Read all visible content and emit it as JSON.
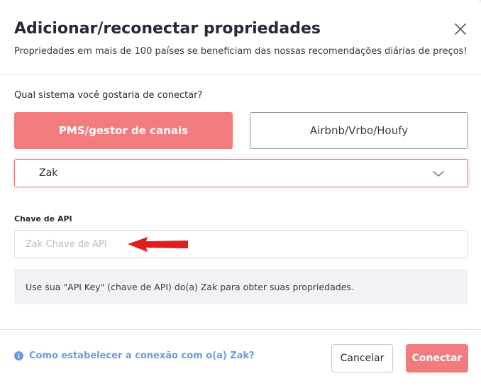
{
  "dialog": {
    "title": "Adicionar/reconectar propriedades",
    "subtitle": "Propriedades em mais de 100 países se beneficiam das nossas recomendações diárias de preços!",
    "close_icon": "close-icon"
  },
  "system_selection": {
    "question": "Qual sistema você gostaria de conectar?",
    "options": [
      {
        "label": "PMS/gestor de canais",
        "selected": true
      },
      {
        "label": "Airbnb/Vrbo/Houfy",
        "selected": false
      }
    ],
    "dropdown": {
      "selected_value": "Zak",
      "icon": "chevron-down-icon"
    }
  },
  "api_key": {
    "label": "Chave de API",
    "placeholder": "Zak Chave de API",
    "value": "",
    "annotation_icon": "red-arrow-icon",
    "annotation_color": "#e01e1e"
  },
  "info": {
    "text": "Use sua \"API Key\" (chave de API) do(a) Zak para obter suas propriedades."
  },
  "footer": {
    "help_icon": "info-icon",
    "help_link": "Como estabelecer a conexão com o(a) Zak?",
    "cancel_label": "Cancelar",
    "connect_label": "Conectar"
  },
  "colors": {
    "accent": "#f27b7e",
    "link": "#6b9bdc"
  }
}
